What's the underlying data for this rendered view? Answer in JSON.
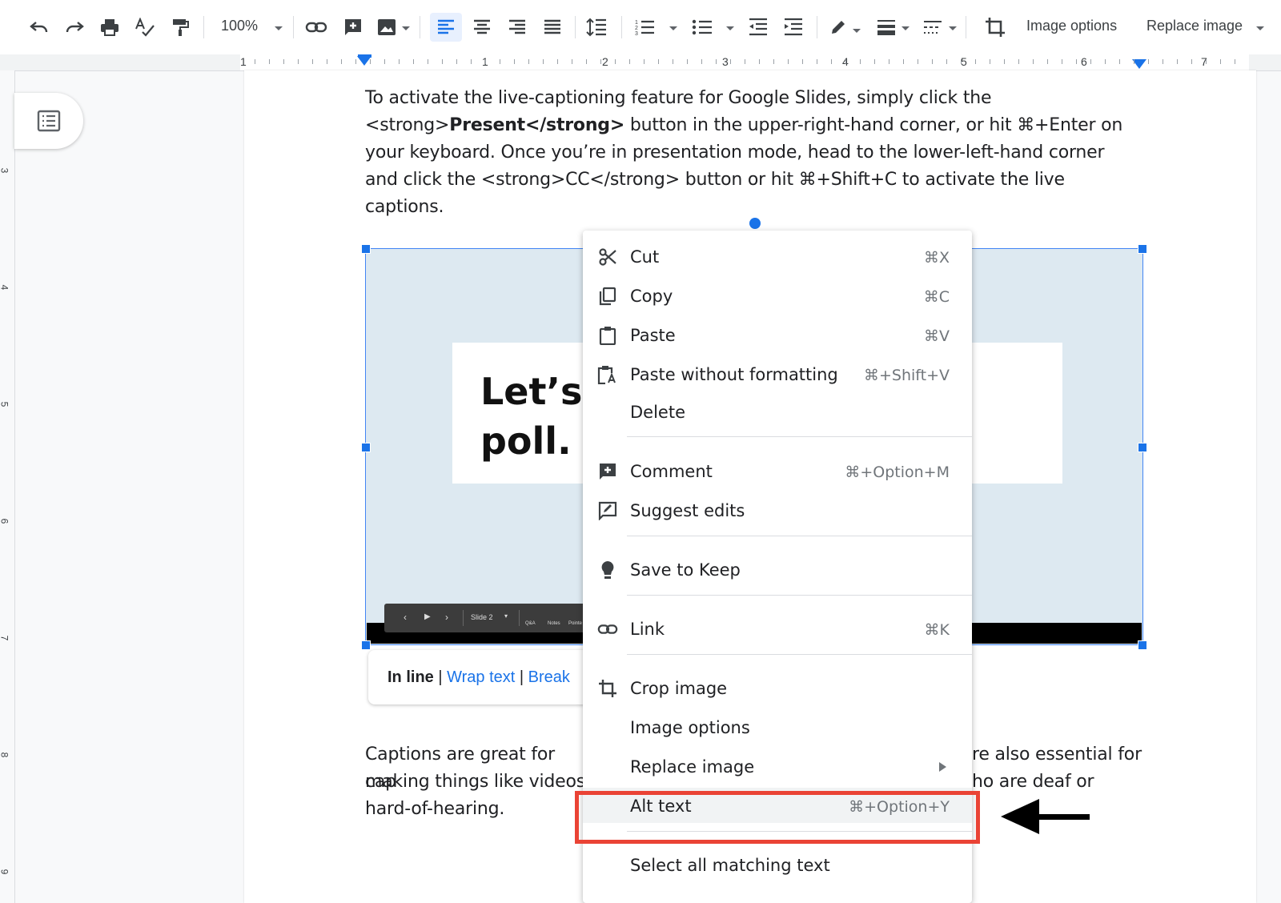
{
  "toolbar": {
    "zoom": "100%",
    "image_options_label": "Image options",
    "replace_image_label": "Replace image"
  },
  "ruler": {
    "numbers": [
      "1",
      "1",
      "2",
      "3",
      "4",
      "5",
      "6",
      "7"
    ],
    "vertical_numbers": [
      "3",
      "4",
      "5",
      "6",
      "7",
      "8",
      "9"
    ]
  },
  "doc": {
    "para1": "To activate the live-captioning feature for Google Slides, simply click the <strong>Present</strong> button in the upper-right-hand corner, or hit ⌘+Enter on your keyboard. Once you’re in presentation mode, head to the lower-left-hand corner and click the <strong>CC</strong> button or hit ⌘+Shift+C to activate the live captions.",
    "para2_left": "Captions are great for cap",
    "para2_right": "re also essential for",
    "para3_left": "making things like videos",
    "para3_right": "ho are deaf or",
    "para4": "hard-of-hearing."
  },
  "image": {
    "slide_text_line1": "Let’s",
    "slide_text_line2": "poll.",
    "slide_label": "Slide 2",
    "ctrl_qa": "Q&A",
    "ctrl_notes": "Notes",
    "ctrl_pointer": "Pointe"
  },
  "wrap": {
    "inline": "In line",
    "sep": "|",
    "wrap_text": "Wrap text",
    "break_text": "Break"
  },
  "menu": {
    "items": [
      {
        "label": "Cut",
        "shortcut": "⌘X",
        "icon": "scissors-icon"
      },
      {
        "label": "Copy",
        "shortcut": "⌘C",
        "icon": "copy-icon"
      },
      {
        "label": "Paste",
        "shortcut": "⌘V",
        "icon": "clipboard-icon"
      },
      {
        "label": "Paste without formatting",
        "shortcut": "⌘+Shift+V",
        "icon": "clipboard-text-icon"
      },
      {
        "label": "Delete",
        "shortcut": "",
        "icon": ""
      },
      {
        "label": "Comment",
        "shortcut": "⌘+Option+M",
        "icon": "add-comment-icon"
      },
      {
        "label": "Suggest edits",
        "shortcut": "",
        "icon": "suggest-edit-icon"
      },
      {
        "label": "Save to Keep",
        "shortcut": "",
        "icon": "lightbulb-icon"
      },
      {
        "label": "Link",
        "shortcut": "⌘K",
        "icon": "link-icon"
      },
      {
        "label": "Crop image",
        "shortcut": "",
        "icon": "crop-icon"
      },
      {
        "label": "Image options",
        "shortcut": "",
        "icon": ""
      },
      {
        "label": "Replace image",
        "shortcut": "",
        "icon": ""
      },
      {
        "label": "Alt text",
        "shortcut": "⌘+Option+Y",
        "icon": ""
      },
      {
        "label": "Select all matching text",
        "shortcut": "",
        "icon": ""
      }
    ]
  },
  "colors": {
    "accent": "#1a73e8",
    "highlight_box": "#ea4335",
    "image_bg": "#dde9f1"
  }
}
